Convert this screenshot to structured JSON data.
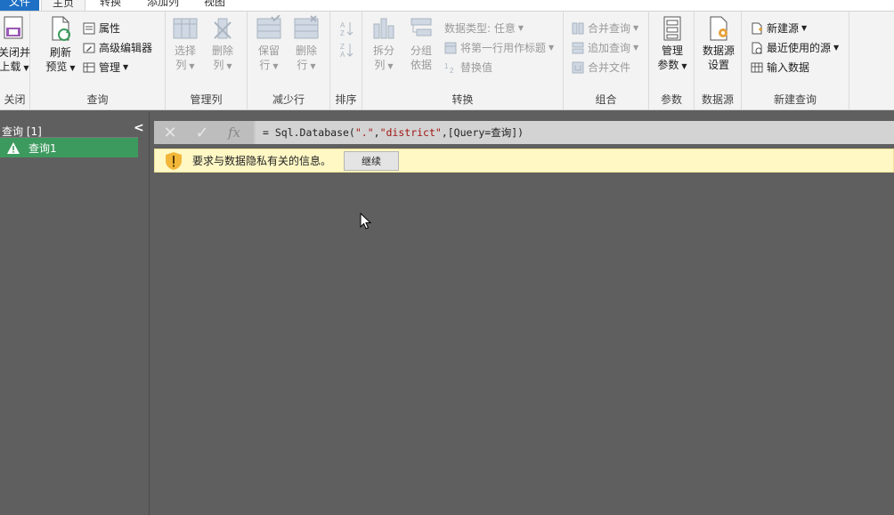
{
  "tabs": {
    "file": "文件",
    "home": "主页",
    "transform": "转换",
    "add_column": "添加列",
    "view": "视图"
  },
  "ribbon": {
    "close_group": {
      "label": "关闭",
      "close_load_l1": "关闭并",
      "close_load_l2": "上载"
    },
    "query_group": {
      "label": "查询",
      "refresh_l1": "刷新",
      "refresh_l2": "预览",
      "properties": "属性",
      "advanced_editor": "高级编辑器",
      "manage": "管理"
    },
    "manage_cols_group": {
      "label": "管理列",
      "choose_l1": "选择",
      "choose_l2": "列",
      "remove_l1": "删除",
      "remove_l2": "列"
    },
    "reduce_rows_group": {
      "label": "减少行",
      "keep_l1": "保留",
      "keep_l2": "行",
      "remove_l1": "删除",
      "remove_l2": "行"
    },
    "sort_group": {
      "label": "排序"
    },
    "transform_group": {
      "label": "转换",
      "split_l1": "拆分",
      "split_l2": "列",
      "group_l1": "分组",
      "group_l2": "依据",
      "data_type": "数据类型: 任意",
      "first_row_header": "将第一行用作标题",
      "replace_values": "替换值"
    },
    "combine_group": {
      "label": "组合",
      "merge_queries": "合并查询",
      "append_queries": "追加查询",
      "combine_files": "合并文件"
    },
    "params_group": {
      "label": "参数",
      "manage_params_l1": "管理",
      "manage_params_l2": "参数"
    },
    "datasource_group": {
      "label": "数据源",
      "settings_l1": "数据源",
      "settings_l2": "设置"
    },
    "newquery_group": {
      "label": "新建查询",
      "new_source": "新建源",
      "recent_sources": "最近使用的源",
      "enter_data": "输入数据"
    }
  },
  "left_pane": {
    "title": "查询 [1]",
    "items": [
      {
        "label": "查询1"
      }
    ]
  },
  "formula_bar": {
    "prefix": "= Sql.Database(",
    "arg1": "\".\"",
    "comma": ",",
    "arg2": "\"district\"",
    "suffix": ",[Query=查询])"
  },
  "warning": {
    "message": "要求与数据隐私有关的信息。",
    "continue": "继续"
  },
  "colors": {
    "accent_blue": "#1e70c4",
    "query_green": "#3d9a5e",
    "warning_bg": "#fff8c5",
    "canvas": "#5f5f5f"
  }
}
